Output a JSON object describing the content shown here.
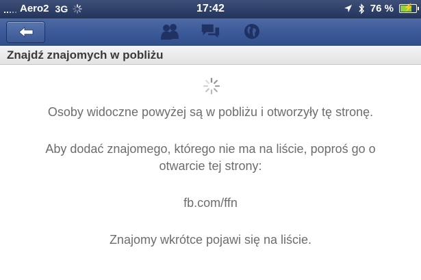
{
  "status_bar": {
    "carrier": "Aero2",
    "network": "3G",
    "time": "17:42",
    "battery_text": "76 %",
    "battery_level": 0.76
  },
  "nav_bar": {
    "back_icon": "arrow-left-icon",
    "icons": [
      "friends-icon",
      "messages-icon",
      "globe-icon"
    ]
  },
  "section": {
    "title": "Znajdź znajomych w pobliżu"
  },
  "content": {
    "nearby_text": "Osoby widoczne powyżej są w pobliżu i otworzyły tę stronę.",
    "add_friend_line1": "Aby dodać znajomego, którego nie ma na liście, poproś go o",
    "add_friend_line2": "otwarcie tej strony:",
    "url": "fb.com/ffn",
    "soon_text": "Znajomy wkrótce pojawi się na liście."
  },
  "colors": {
    "facebook_blue": "#3b5998",
    "status_bar": "#2b3c63",
    "body_text": "#6c6c6c",
    "header_text": "#3a3a3a"
  }
}
